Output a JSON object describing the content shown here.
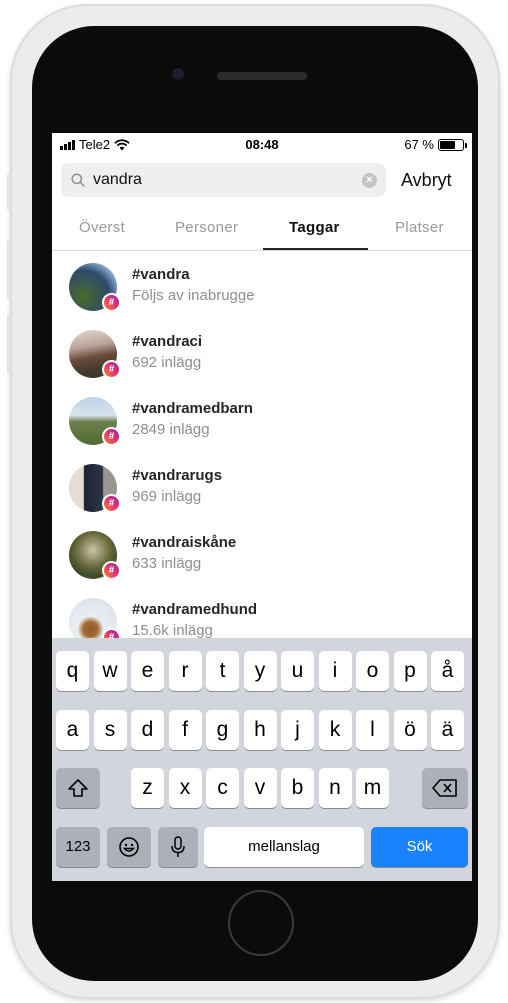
{
  "status_bar": {
    "carrier": "Tele2",
    "time": "08:48",
    "battery": "67 %",
    "battery_level": 0.67
  },
  "search": {
    "value": "vandra",
    "cancel_label": "Avbryt"
  },
  "tabs": [
    {
      "label": "Överst",
      "active": false
    },
    {
      "label": "Personer",
      "active": false
    },
    {
      "label": "Taggar",
      "active": true
    },
    {
      "label": "Platser",
      "active": false
    }
  ],
  "results": [
    {
      "name": "#vandra",
      "subtitle": "Följs av inabrugge"
    },
    {
      "name": "#vandraci",
      "subtitle": "692 inlägg"
    },
    {
      "name": "#vandramedbarn",
      "subtitle": "2849 inlägg"
    },
    {
      "name": "#vandrarugs",
      "subtitle": "969 inlägg"
    },
    {
      "name": "#vandraiskåne",
      "subtitle": "633 inlägg"
    },
    {
      "name": "#vandramedhund",
      "subtitle": "15.6k inlägg"
    }
  ],
  "hash_symbol": "#",
  "keyboard": {
    "row1": [
      "q",
      "w",
      "e",
      "r",
      "t",
      "y",
      "u",
      "i",
      "o",
      "p",
      "å"
    ],
    "row2": [
      "a",
      "s",
      "d",
      "f",
      "g",
      "h",
      "j",
      "k",
      "l",
      "ö",
      "ä"
    ],
    "row3": [
      "z",
      "x",
      "c",
      "v",
      "b",
      "n",
      "m"
    ],
    "numbers_label": "123",
    "space_label": "mellanslag",
    "return_label": "Sök"
  },
  "colors": {
    "accent_blue": "#1a82fb",
    "keyboard_bg": "#d2d5db",
    "hashtag_badge_gradient": [
      "#f58529",
      "#dd2a7b",
      "#8134af"
    ]
  }
}
